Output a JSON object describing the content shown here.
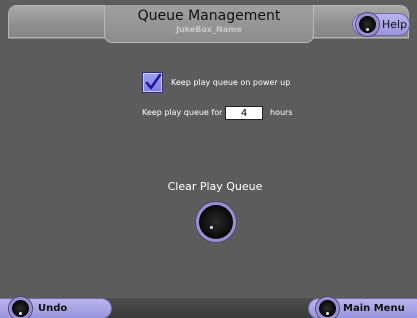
{
  "header": {
    "title": "Queue Management",
    "subtitle": "JukeBox_Name",
    "help_label": "Help"
  },
  "settings": {
    "keep_on_powerup_label": "Keep play queue on power up",
    "keep_on_powerup_checked": true,
    "keep_for_prefix": "Keep play queue for",
    "keep_for_value": "4",
    "keep_for_suffix": "hours"
  },
  "clear_queue": {
    "label": "Clear Play Queue"
  },
  "footer": {
    "undo_label": "Undo",
    "main_menu_label": "Main Menu"
  },
  "colors": {
    "background": "#5c5c5c",
    "header": "#959595",
    "button_accent": "#9a95dc",
    "knob_ring": "#9a8fd6",
    "checkbox_fill": "#8f90e6",
    "checkmark": "#1a1aa0"
  },
  "icons": {
    "help": "knob-icon",
    "clear": "knob-icon",
    "undo": "knob-icon",
    "main_menu": "knob-icon",
    "checkbox": "checkmark-icon"
  }
}
